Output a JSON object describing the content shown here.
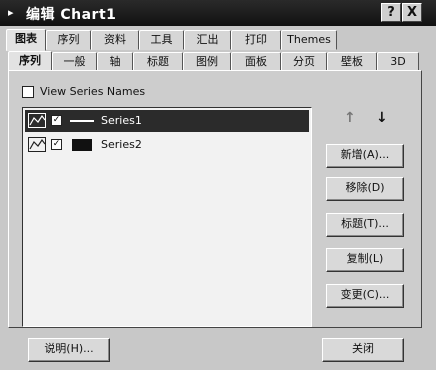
{
  "window": {
    "title": "编辑 Chart1",
    "help_button": "?",
    "close_button": "X"
  },
  "tabs_top": [
    "图表",
    "序列",
    "资料",
    "工具",
    "汇出",
    "打印",
    "Themes"
  ],
  "tabs_sub": [
    "序列",
    "一般",
    "轴",
    "标题",
    "图例",
    "面板",
    "分页",
    "壁板",
    "3D"
  ],
  "view_series_names_label": "View Series Names",
  "series": [
    {
      "name": "Series1",
      "checked": "✓",
      "swatch_type": "line"
    },
    {
      "name": "Series2",
      "checked": "✓",
      "swatch_type": "box"
    }
  ],
  "order_arrows": {
    "up": "↑",
    "down": "↓"
  },
  "actions": {
    "add": "新增(A)...",
    "remove": "移除(D)",
    "title": "标题(T)...",
    "clone": "复制(L)",
    "change": "变更(C)..."
  },
  "footer": {
    "help": "说明(H)...",
    "close": "关闭"
  },
  "colors": {
    "titlebar": "#1a1a1a",
    "selection": "#2b2b2b",
    "dialog": "#c8c8c8"
  }
}
